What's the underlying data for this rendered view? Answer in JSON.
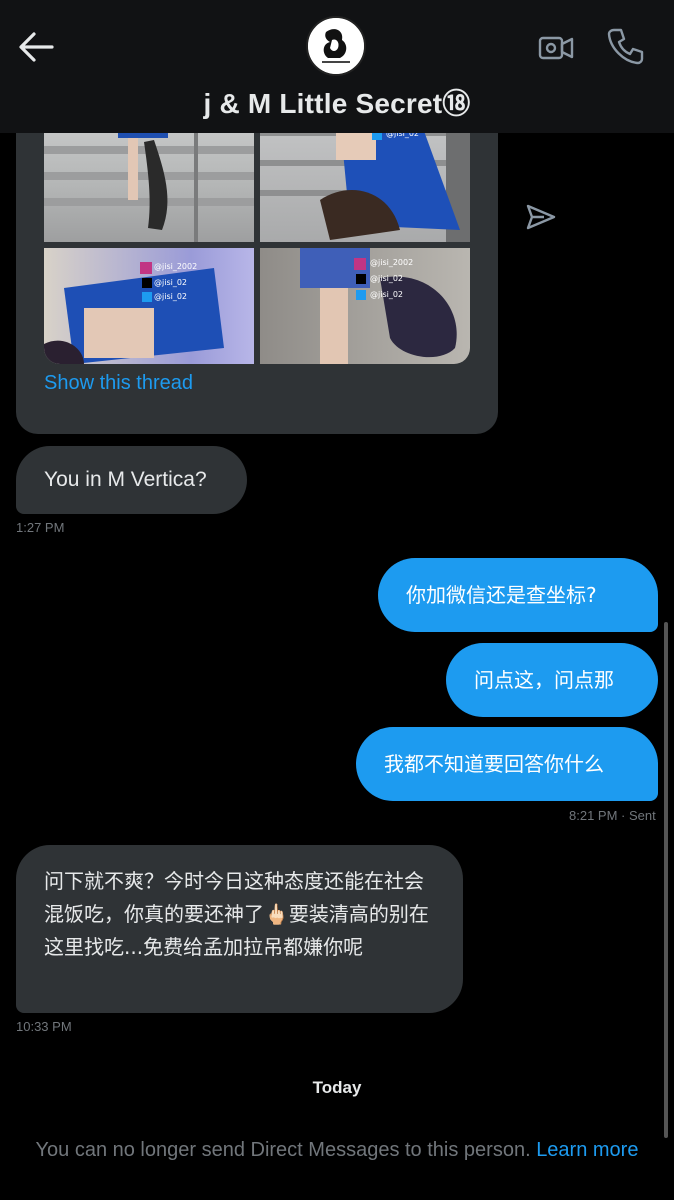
{
  "header": {
    "title": "j & M Little Secret⑱",
    "back_icon": "arrow-left-icon",
    "video_icon": "video-camera-icon",
    "call_icon": "phone-icon"
  },
  "shared_tweet": {
    "show_thread": "Show this thread",
    "watermarks": [
      "@jisi_2002",
      "@jisi_02",
      "@jisi_02"
    ]
  },
  "messages": [
    {
      "side": "in",
      "text": "You in M Vertica?"
    },
    {
      "side": "out",
      "text": "你加微信还是查坐标?"
    },
    {
      "side": "out",
      "text": "问点这，问点那"
    },
    {
      "side": "out",
      "text": "我都不知道要回答你什么"
    },
    {
      "side": "in",
      "text": "问下就不爽？今时今日这种态度还能在社会混饭吃，你真的要还神了🖕🏻要装清高的别在这里找吃...免费给孟加拉吊都嫌你呢"
    }
  ],
  "timestamps": {
    "t1": "1:27 PM",
    "t2": "8:21 PM · Sent",
    "t3": "10:33 PM"
  },
  "day_divider": "Today",
  "notice": {
    "text": "You can no longer send Direct Messages to this person.",
    "link": "Learn more"
  },
  "colors": {
    "accent": "#1d9bf0",
    "incoming_bubble": "#2f3336",
    "background": "#000000"
  }
}
